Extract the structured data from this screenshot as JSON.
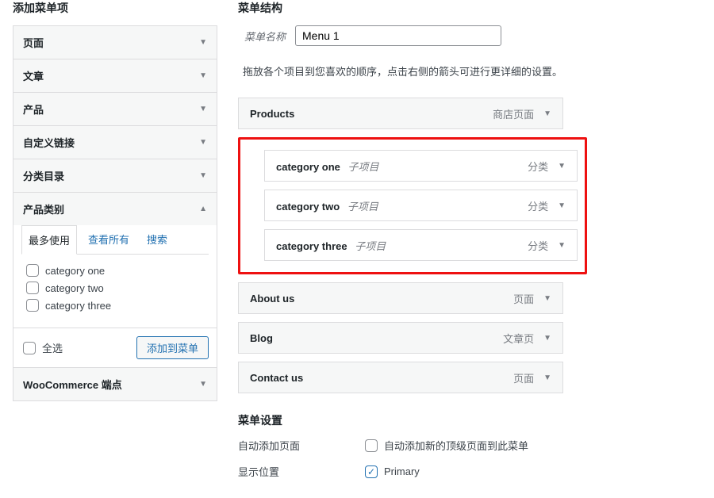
{
  "left": {
    "heading": "添加菜单项",
    "accordion": [
      {
        "label": "页面",
        "open": false
      },
      {
        "label": "文章",
        "open": false
      },
      {
        "label": "产品",
        "open": false
      },
      {
        "label": "自定义链接",
        "open": false
      },
      {
        "label": "分类目录",
        "open": false
      },
      {
        "label": "产品类别",
        "open": true
      }
    ],
    "tabs": {
      "most_used": "最多使用",
      "view_all": "查看所有",
      "search": "搜索"
    },
    "checks": [
      {
        "label": "category one"
      },
      {
        "label": "category two"
      },
      {
        "label": "category three"
      }
    ],
    "select_all": "全选",
    "add_button": "添加到菜单",
    "wc_endpoints": "WooCommerce 端点"
  },
  "right": {
    "heading": "菜单结构",
    "menu_name_label": "菜单名称",
    "menu_name_value": "Menu 1",
    "hint": "拖放各个项目到您喜欢的顺序，点击右侧的箭头可进行更详细的设置。",
    "items": {
      "products": {
        "title": "Products",
        "type": "商店页面"
      },
      "children": [
        {
          "title": "category one",
          "sub": "子项目",
          "type": "分类"
        },
        {
          "title": "category two",
          "sub": "子项目",
          "type": "分类"
        },
        {
          "title": "category three",
          "sub": "子项目",
          "type": "分类"
        }
      ],
      "about": {
        "title": "About us",
        "type": "页面"
      },
      "blog": {
        "title": "Blog",
        "type": "文章页"
      },
      "contact": {
        "title": "Contact us",
        "type": "页面"
      }
    },
    "settings": {
      "heading": "菜单设置",
      "auto_label": "自动添加页面",
      "auto_desc": "自动添加新的顶级页面到此菜单",
      "loc_label": "显示位置",
      "loc_primary": "Primary"
    }
  }
}
